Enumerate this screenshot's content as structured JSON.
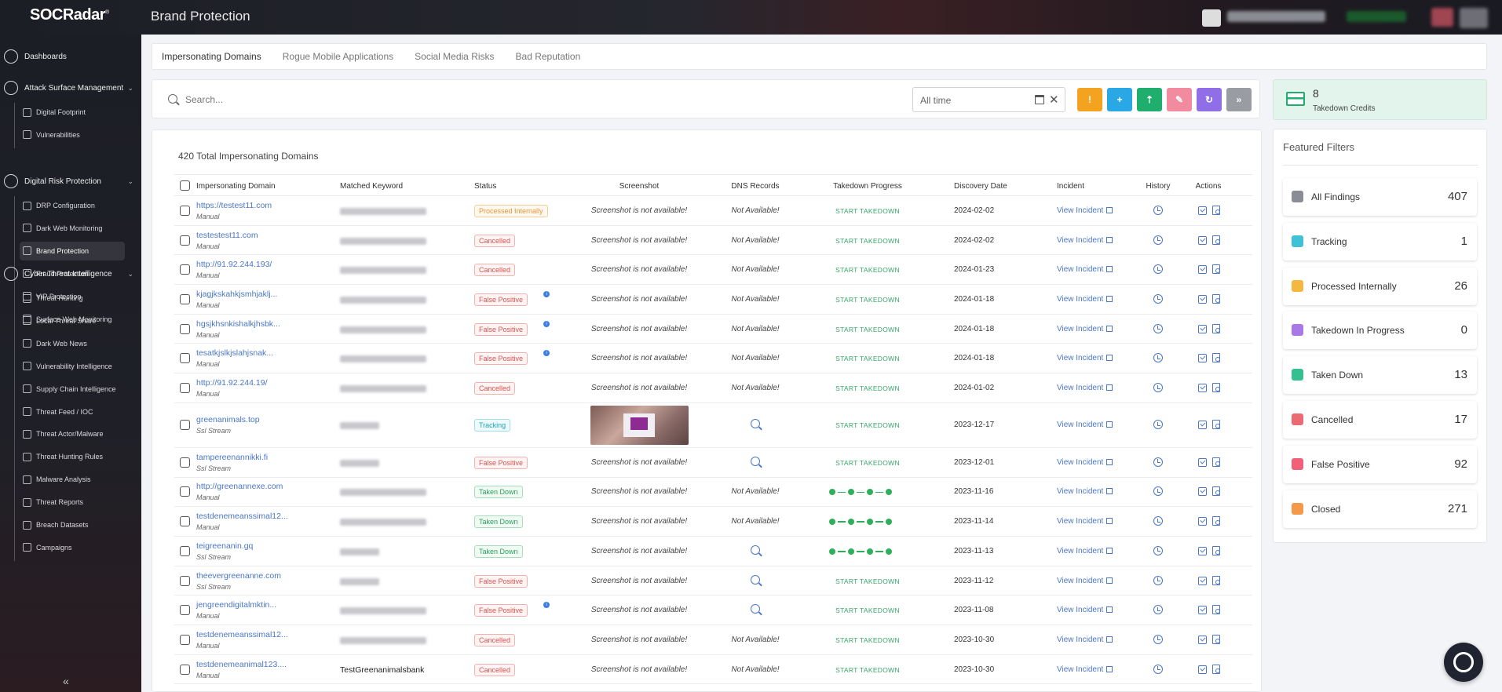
{
  "app": {
    "logo": "SOCRadar",
    "logo_mark": "®",
    "title": "Brand Protection"
  },
  "sidebar": {
    "sections": [
      {
        "label": "Dashboards",
        "icon": "dashboard-icon",
        "items": []
      },
      {
        "label": "Attack Surface Management",
        "icon": "attack-surface-icon",
        "items": [
          "Digital Footprint",
          "Vulnerabilities"
        ]
      },
      {
        "label": "Digital Risk Protection",
        "icon": "digital-risk-icon",
        "items": [
          "DRP Configuration",
          "Dark Web Monitoring",
          "Brand Protection",
          "Fraud Protection",
          "VIP Protection",
          "Surface Web Monitoring"
        ]
      },
      {
        "label": "Cyber Threat Intelligence",
        "icon": "cti-icon",
        "items": [
          "Threat Hunting",
          "Local Threat Share",
          "Dark Web News",
          "Vulnerability Intelligence",
          "Supply Chain Intelligence",
          "Threat Feed / IOC",
          "Threat Actor/Malware",
          "Threat Hunting Rules",
          "Malware Analysis",
          "Threat Reports",
          "Breach Datasets",
          "Campaigns"
        ]
      }
    ],
    "active_item": "Brand Protection",
    "collapse_glyph": "«"
  },
  "tabs": [
    {
      "label": "Impersonating Domains",
      "active": true
    },
    {
      "label": "Rogue Mobile Applications",
      "active": false
    },
    {
      "label": "Social Media Risks",
      "active": false
    },
    {
      "label": "Bad Reputation",
      "active": false
    }
  ],
  "search": {
    "placeholder": "Search...",
    "value": ""
  },
  "date_filter": {
    "value": "All time",
    "clear_glyph": "✕"
  },
  "action_buttons": [
    {
      "name": "info-button",
      "glyph": "!",
      "color": "#f4a321"
    },
    {
      "name": "add-button",
      "glyph": "+",
      "color": "#2aa8e6"
    },
    {
      "name": "upload-button",
      "glyph": "⇡",
      "color": "#1fae6e"
    },
    {
      "name": "feedback-button",
      "glyph": "✎",
      "color": "#f28aa0"
    },
    {
      "name": "refresh-button",
      "glyph": "↻",
      "color": "#8f6ee8"
    },
    {
      "name": "expand-button",
      "glyph": "»",
      "color": "#9a9ca3"
    }
  ],
  "credits": {
    "count": "8",
    "label": "Takedown Credits"
  },
  "featured_filters": {
    "title": "Featured Filters",
    "items": [
      {
        "label": "All Findings",
        "count": "407",
        "color": "#8a8d96"
      },
      {
        "label": "Tracking",
        "count": "1",
        "color": "#3fc2d6"
      },
      {
        "label": "Processed Internally",
        "count": "26",
        "color": "#f4b740"
      },
      {
        "label": "Takedown In Progress",
        "count": "0",
        "color": "#a979e8"
      },
      {
        "label": "Taken Down",
        "count": "13",
        "color": "#36c090"
      },
      {
        "label": "Cancelled",
        "count": "17",
        "color": "#ec6b72"
      },
      {
        "label": "False Positive",
        "count": "92",
        "color": "#f25f78"
      },
      {
        "label": "Closed",
        "count": "271",
        "color": "#f4994a"
      }
    ]
  },
  "table": {
    "total_label": "420 Total Impersonating Domains",
    "columns": [
      "Impersonating Domain",
      "Matched Keyword",
      "Status",
      "Screenshot",
      "DNS Records",
      "Takedown Progress",
      "Discovery Date",
      "Incident",
      "History",
      "Actions"
    ],
    "na_screenshot": "Screenshot is not available!",
    "na_dns": "Not Available!",
    "takedown_label": "START TAKEDOWN",
    "incident_label": "View Incident",
    "rows": [
      {
        "domain": "https://testest11.com",
        "source": "Manual",
        "keyword": "",
        "status": "Processed Internally",
        "status_class": "b-processed",
        "info": false,
        "screenshot": "na",
        "dns": "na",
        "progress": "start",
        "date": "2024-02-02"
      },
      {
        "domain": "testestest11.com",
        "source": "Manual",
        "keyword": "",
        "status": "Cancelled",
        "status_class": "b-cancelled",
        "info": false,
        "screenshot": "na",
        "dns": "na",
        "progress": "start",
        "date": "2024-02-02"
      },
      {
        "domain": "http://91.92.244.193/",
        "source": "Manual",
        "keyword": "",
        "status": "Cancelled",
        "status_class": "b-cancelled",
        "info": false,
        "screenshot": "na",
        "dns": "na",
        "progress": "start",
        "date": "2024-01-23"
      },
      {
        "domain": "kjagjkskahkjsmhjaklj...",
        "source": "Manual",
        "keyword": "",
        "status": "False Positive",
        "status_class": "b-false",
        "info": true,
        "screenshot": "na",
        "dns": "na",
        "progress": "start",
        "date": "2024-01-18"
      },
      {
        "domain": "hgsjkhsnkishalkjhsbk...",
        "source": "Manual",
        "keyword": "",
        "status": "False Positive",
        "status_class": "b-false",
        "info": true,
        "screenshot": "na",
        "dns": "na",
        "progress": "start",
        "date": "2024-01-18"
      },
      {
        "domain": "tesatkjslkjslahjsnak...",
        "source": "Manual",
        "keyword": "",
        "status": "False Positive",
        "status_class": "b-false",
        "info": true,
        "screenshot": "na",
        "dns": "na",
        "progress": "start",
        "date": "2024-01-18"
      },
      {
        "domain": "http://91.92.244.19/",
        "source": "Manual",
        "keyword": "",
        "status": "Cancelled",
        "status_class": "b-cancelled",
        "info": false,
        "screenshot": "na",
        "dns": "na",
        "progress": "start",
        "date": "2024-01-02"
      },
      {
        "domain": "greenanimals.top",
        "source": "Ssl Stream",
        "keyword": "",
        "status": "Tracking",
        "status_class": "b-tracking",
        "info": false,
        "screenshot": "image",
        "dns": "zoom",
        "progress": "start",
        "date": "2023-12-17"
      },
      {
        "domain": "tampereenannikki.fi",
        "source": "Ssl Stream",
        "keyword": "",
        "status": "False Positive",
        "status_class": "b-false",
        "info": false,
        "screenshot": "na",
        "dns": "zoom",
        "progress": "start",
        "date": "2023-12-01"
      },
      {
        "domain": "http://greenannexe.com",
        "source": "Manual",
        "keyword": "",
        "status": "Taken Down",
        "status_class": "b-taken",
        "info": false,
        "screenshot": "na",
        "dns": "na",
        "progress": "done",
        "date": "2023-11-16"
      },
      {
        "domain": "testdenemeanssimal12...",
        "source": "Manual",
        "keyword": "",
        "status": "Taken Down",
        "status_class": "b-taken",
        "info": false,
        "screenshot": "na",
        "dns": "na",
        "progress": "done",
        "date": "2023-11-14"
      },
      {
        "domain": "teigreenanin.gq",
        "source": "Ssl Stream",
        "keyword": "",
        "status": "Taken Down",
        "status_class": "b-taken",
        "info": false,
        "screenshot": "na",
        "dns": "zoom",
        "progress": "done",
        "date": "2023-11-13"
      },
      {
        "domain": "theevergreenanne.com",
        "source": "Ssl Stream",
        "keyword": "",
        "status": "False Positive",
        "status_class": "b-false",
        "info": false,
        "screenshot": "na",
        "dns": "zoom",
        "progress": "start",
        "date": "2023-11-12"
      },
      {
        "domain": "jengreendigitalmktin...",
        "source": "Manual",
        "keyword": "",
        "status": "False Positive",
        "status_class": "b-false",
        "info": true,
        "screenshot": "na",
        "dns": "zoom",
        "progress": "start",
        "date": "2023-11-08"
      },
      {
        "domain": "testdenemeanssimal12...",
        "source": "Manual",
        "keyword": "",
        "status": "Cancelled",
        "status_class": "b-cancelled",
        "info": false,
        "screenshot": "na",
        "dns": "na",
        "progress": "start",
        "date": "2023-10-30"
      },
      {
        "domain": "testdenemeanimal123....",
        "source": "Manual",
        "keyword": "TestGreenanimalsbank",
        "status": "Cancelled",
        "status_class": "b-cancelled",
        "info": false,
        "screenshot": "na",
        "dns": "na",
        "progress": "start",
        "date": "2023-10-30"
      }
    ]
  }
}
